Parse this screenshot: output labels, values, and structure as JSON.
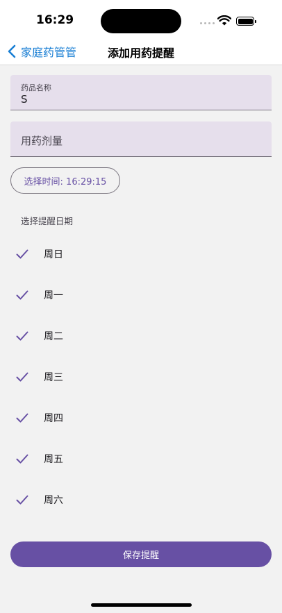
{
  "status_bar": {
    "time": "16:29"
  },
  "nav": {
    "back_label": "家庭药管管",
    "title": "添加用药提醒"
  },
  "form": {
    "medicine_name_label": "药品名称",
    "medicine_name_value": "S",
    "dosage_placeholder": "用药剂量",
    "time_button": "选择时间: 16:29:15",
    "days_section_label": "选择提醒日期",
    "days": [
      {
        "label": "周日",
        "checked": true
      },
      {
        "label": "周一",
        "checked": true
      },
      {
        "label": "周二",
        "checked": true
      },
      {
        "label": "周三",
        "checked": true
      },
      {
        "label": "周四",
        "checked": true
      },
      {
        "label": "周五",
        "checked": true
      },
      {
        "label": "周六",
        "checked": true
      }
    ],
    "save_button": "保存提醒"
  },
  "colors": {
    "accent": "#6750a4",
    "link": "#1a7fd4",
    "field_bg": "#e6dfec"
  }
}
